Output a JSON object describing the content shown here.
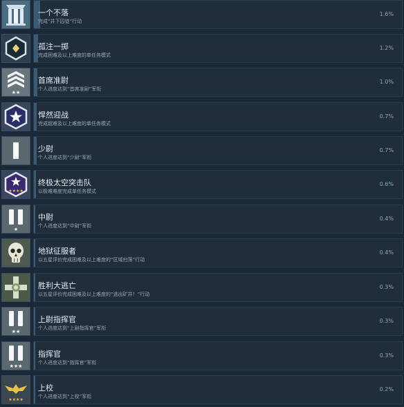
{
  "achievements": [
    {
      "title": "一个不落",
      "desc": "完成“井下囚徒”行动",
      "pct": "1.6%",
      "icon": "pillars-icon",
      "progress": 0.016
    },
    {
      "title": "孤注一掷",
      "desc": "完成困难及以上难度的单任务模式",
      "pct": "1.2%",
      "icon": "diamond-badge-icon",
      "progress": 0.012
    },
    {
      "title": "首席准尉",
      "desc": "个人进度达到“首席准尉”军衔",
      "pct": "1.0%",
      "icon": "chevron-rank-icon",
      "progress": 0.01
    },
    {
      "title": "悍然迎战",
      "desc": "完成超难及以上难度的单任务模式",
      "pct": "0.7%",
      "icon": "star-hexagon-icon",
      "progress": 0.007
    },
    {
      "title": "少尉",
      "desc": "个人进度达到“少尉”军衔",
      "pct": "0.7%",
      "icon": "single-bar-rank-icon",
      "progress": 0.007
    },
    {
      "title": "终极太空突击队",
      "desc": "以极难难度完成单任务模式",
      "pct": "0.6%",
      "icon": "four-star-hexagon-icon",
      "progress": 0.006
    },
    {
      "title": "中尉",
      "desc": "个人进度达到“中尉”军衔",
      "pct": "0.4%",
      "icon": "double-bar-rank-icon",
      "progress": 0.004
    },
    {
      "title": "地狱征服者",
      "desc": "以五星评价完成困难及以上难度的“区域扫荡”行动",
      "pct": "0.4%",
      "icon": "skull-icon",
      "progress": 0.004
    },
    {
      "title": "胜利大逃亡",
      "desc": "以五星评价完成困难及以上难度的“逃出矿井！”行动",
      "pct": "0.3%",
      "icon": "cross-emblem-icon",
      "progress": 0.003
    },
    {
      "title": "上尉指挥官",
      "desc": "个人进度达到“上尉指挥官”军衔",
      "pct": "0.3%",
      "icon": "bars-two-star-icon",
      "progress": 0.003
    },
    {
      "title": "指挥官",
      "desc": "个人进度达到“指挥官”军衔",
      "pct": "0.3%",
      "icon": "bars-three-star-icon",
      "progress": 0.003
    },
    {
      "title": "上校",
      "desc": "个人进度达到“上校”军衔",
      "pct": "0.2%",
      "icon": "eagle-rank-icon",
      "progress": 0.002
    }
  ]
}
